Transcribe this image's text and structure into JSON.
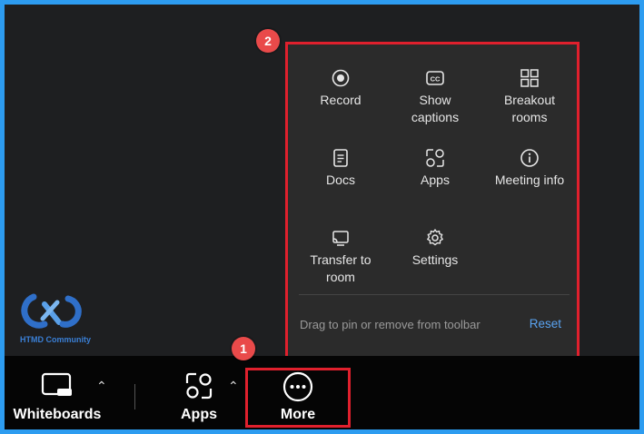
{
  "menu": {
    "items": [
      {
        "label": "Record",
        "icon": "record-icon"
      },
      {
        "label": "Show\ncaptions",
        "icon": "captions-icon"
      },
      {
        "label": "Breakout\nrooms",
        "icon": "breakout-rooms-icon"
      },
      {
        "label": "Docs",
        "icon": "docs-icon"
      },
      {
        "label": "Apps",
        "icon": "apps-icon"
      },
      {
        "label": "Meeting info",
        "icon": "info-icon"
      },
      {
        "label": "Transfer to\nroom",
        "icon": "cast-icon"
      },
      {
        "label": "Settings",
        "icon": "gear-icon"
      }
    ],
    "hint": "Drag to pin or remove from toolbar",
    "reset_label": "Reset"
  },
  "badges": {
    "one": "1",
    "two": "2"
  },
  "toolbar": {
    "whiteboards_label": "Whiteboards",
    "apps_label": "Apps",
    "more_label": "More"
  },
  "logo": {
    "text": "HTMD Community"
  },
  "colors": {
    "accent": "#5aa3f0",
    "highlight": "#e0202d",
    "badge": "#e94a4a",
    "frame": "#2d9cf0"
  }
}
